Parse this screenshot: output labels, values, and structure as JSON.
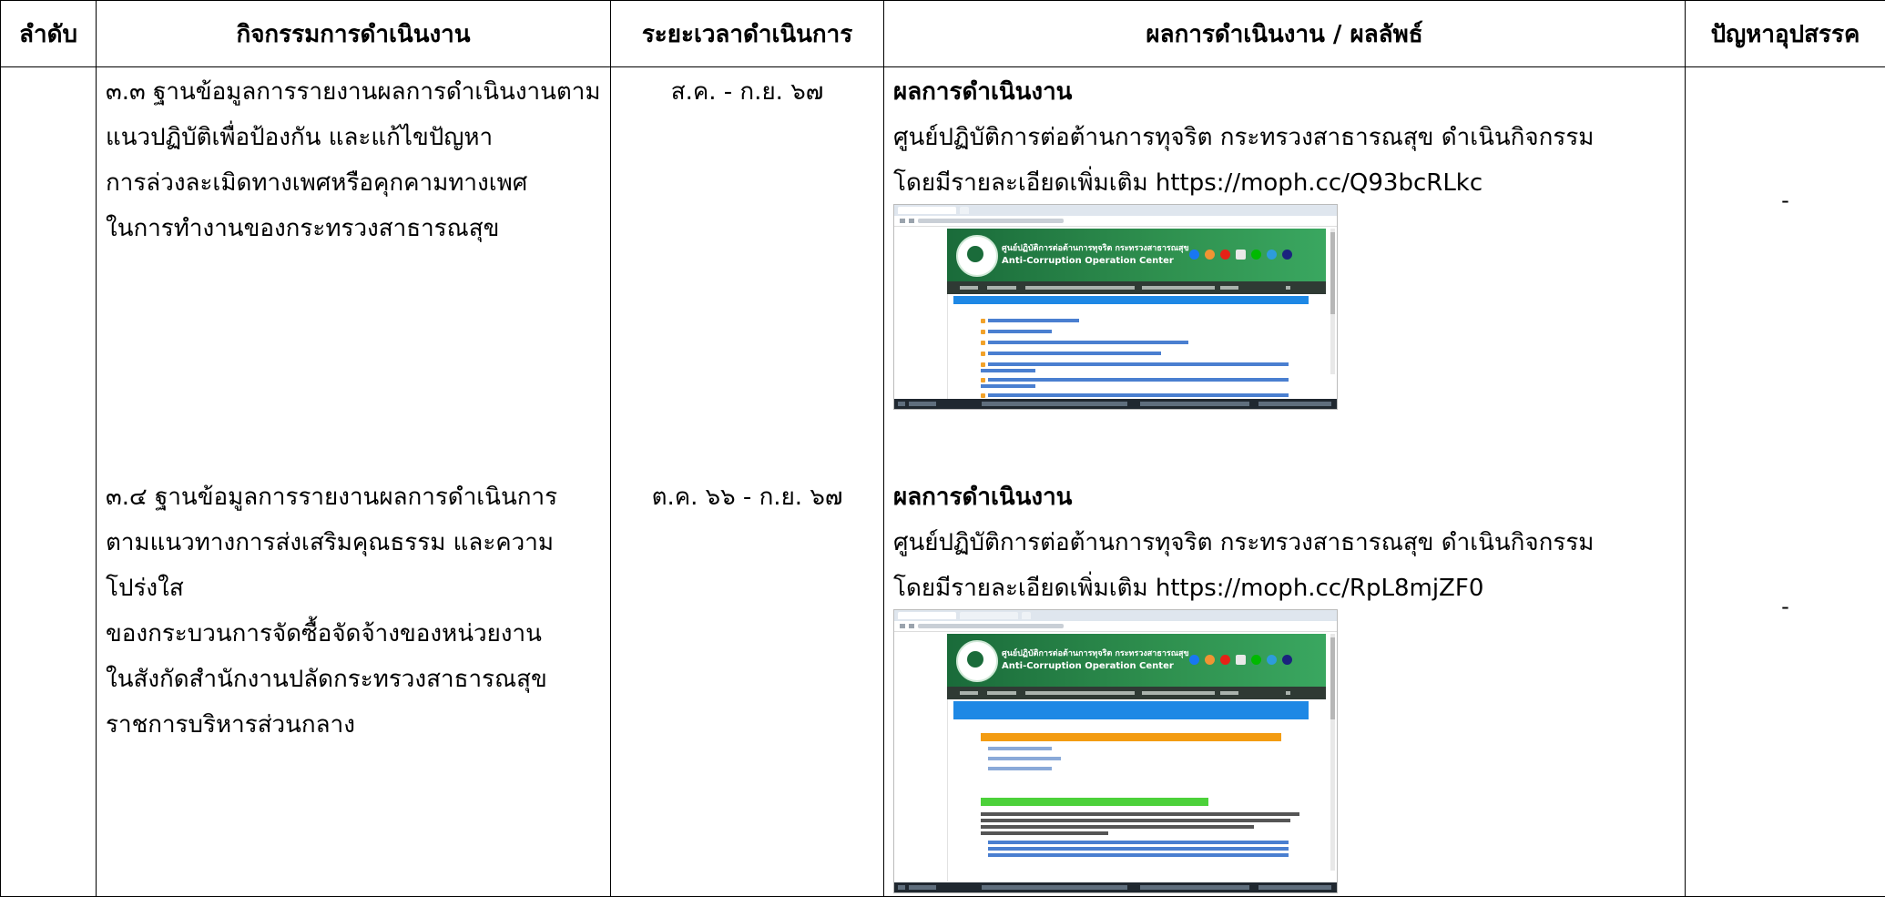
{
  "table": {
    "headers": [
      "ลำดับ",
      "กิจกรรมการดำเนินงาน",
      "ระยะเวลาดำเนินการ",
      "ผลการดำเนินงาน / ผลลัพธ์",
      "ปัญหาอุปสรรค"
    ],
    "rows": [
      {
        "activity_lines": [
          "๓.๓ ฐานข้อมูลการรายงานผลการดำเนินงานตาม",
          "แนวปฏิบัติเพื่อป้องกัน และแก้ไขปัญหา",
          "การล่วงละเมิดทางเพศหรือคุกคามทางเพศ",
          "ในการทำงานของกระทรวงสาธารณสุข"
        ],
        "period": "ส.ค. - ก.ย. ๖๗",
        "result_heading": "ผลการดำเนินงาน",
        "result_lines": [
          "ศูนย์ปฏิบัติการต่อต้านการทุจริต กระทรวงสาธารณสุข ดำเนินกิจกรรม",
          "โดยมีรายละเอียดเพิ่มเติม https://moph.cc/Q93bcRLkc"
        ],
        "problem": "-",
        "screenshot": {
          "banner_title": "ศูนย์ปฏิบัติการต่อต้านการทุจริต กระทรวงสาธารณสุข",
          "banner_subtitle": "Anti-Corruption Operation Center"
        }
      },
      {
        "activity_lines": [
          "๓.๔ ฐานข้อมูลการรายงานผลการดำเนินการ",
          "ตามแนวทางการส่งเสริมคุณธรรม และความโปร่งใส",
          "ของกระบวนการจัดซื้อจัดจ้างของหน่วยงาน",
          "ในสังกัดสำนักงานปลัดกระทรวงสาธารณสุข",
          "ราชการบริหารส่วนกลาง"
        ],
        "period": "ต.ค. ๖๖ - ก.ย. ๖๗",
        "result_heading": "ผลการดำเนินงาน",
        "result_lines": [
          "ศูนย์ปฏิบัติการต่อต้านการทุจริต กระทรวงสาธารณสุข ดำเนินกิจกรรม",
          "โดยมีรายละเอียดเพิ่มเติม https://moph.cc/RpL8mjZF0"
        ],
        "problem": "-",
        "screenshot": {
          "banner_title": "ศูนย์ปฏิบัติการต่อต้านการทุจริต กระทรวงสาธารณสุข",
          "banner_subtitle": "Anti-Corruption Operation Center"
        }
      }
    ]
  },
  "colors": {
    "banner_green": "#2e8f4e",
    "header_blue": "#1e88e5",
    "highlight_orange": "#f39c12",
    "highlight_green": "#4cd13a"
  },
  "icons": [
    "facebook-icon",
    "instagram-icon",
    "youtube-icon",
    "document-icon",
    "chat-icon",
    "email-icon",
    "link-icon"
  ]
}
